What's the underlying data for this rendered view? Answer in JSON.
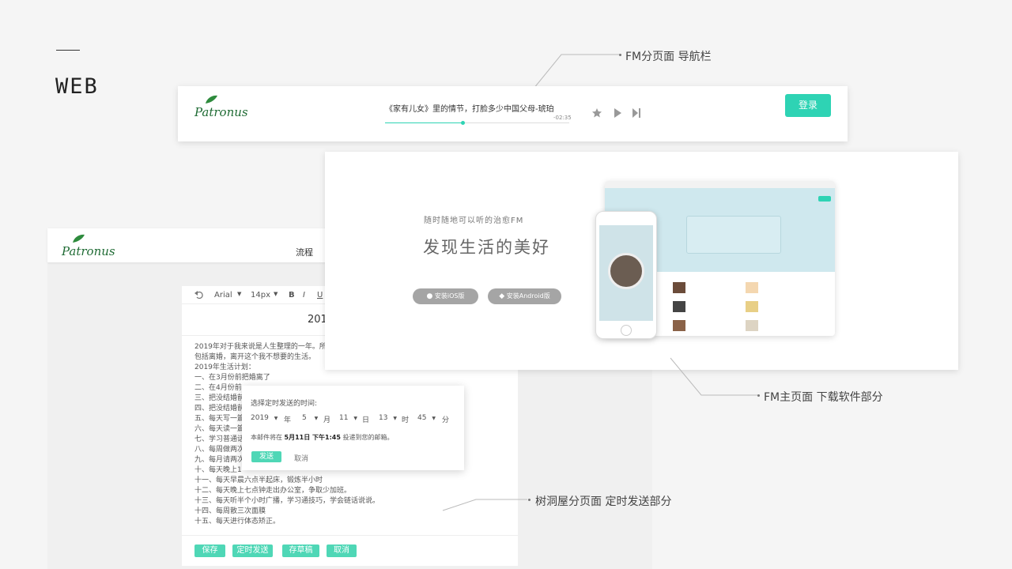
{
  "section": {
    "label": "WEB"
  },
  "callouts": {
    "nav": "FM分页面 导航栏",
    "download": "FM主页面 下载软件部分",
    "schedule": "树洞屋分页面 定时发送部分"
  },
  "navbar": {
    "logo": "Patronus",
    "track_title": "《家有儿女》里的情节，打脸多少中国父母-琥珀",
    "time": "-02:35",
    "progress": 0.42,
    "login_label": "登录"
  },
  "fm_main": {
    "tagline": "随时随地可以听的治愈FM",
    "headline": "发现生活的美好",
    "ios_label": "安装iOS版",
    "android_label": "安装Android版"
  },
  "editor": {
    "logo": "Patronus",
    "nav_item": "流程",
    "toolbar": {
      "font": "Arial",
      "size": "14px",
      "bold": "B",
      "italic": "I",
      "underline": "U"
    },
    "doc_title": "201",
    "lines": [
      "2019年对于我来说是人生整理的一年。所以对",
      "包括离婚，离开这个我不想要的生活。",
      "2019年生活计划：",
      "一、在3月份前把婚离了",
      "二、在4月份前",
      "三、把没结婚前",
      "四、把没结婚前",
      "五、每天写一篇",
      "六、每天读一篇",
      "七、学习普通话",
      "八、每周做两次",
      "九、每月请两次",
      "十、每天晚上1",
      "十一、每天早晨六点半起床，锻炼半小时",
      "十二、每天晚上七点钟走出办公室，争取少加班。",
      "十三、每天听半个小时广播，学习通技巧，学会链话说说。",
      "十四、每周散三次面膜",
      "十五、每天进行体态矫正。"
    ],
    "buttons": {
      "save": "保存",
      "schedule": "定时发送",
      "draft": "存草稿",
      "cancel": "取消"
    }
  },
  "schedule_dialog": {
    "title": "选择定时发送的时间:",
    "year": "2019",
    "year_unit": "年",
    "month": "5",
    "month_unit": "月",
    "day": "11",
    "day_unit": "日",
    "hour": "13",
    "hour_unit": "时",
    "minute": "45",
    "minute_unit": "分",
    "notice_prefix": "本邮件将在",
    "notice_time": "5月11日 下午1:45",
    "notice_suffix": "投递到您的邮箱。",
    "send_label": "发送",
    "cancel_label": "取消"
  },
  "colors": {
    "accent": "#2ed3b4",
    "logo_green": "#1f6b34",
    "pill_gray": "#a5a5a5"
  }
}
